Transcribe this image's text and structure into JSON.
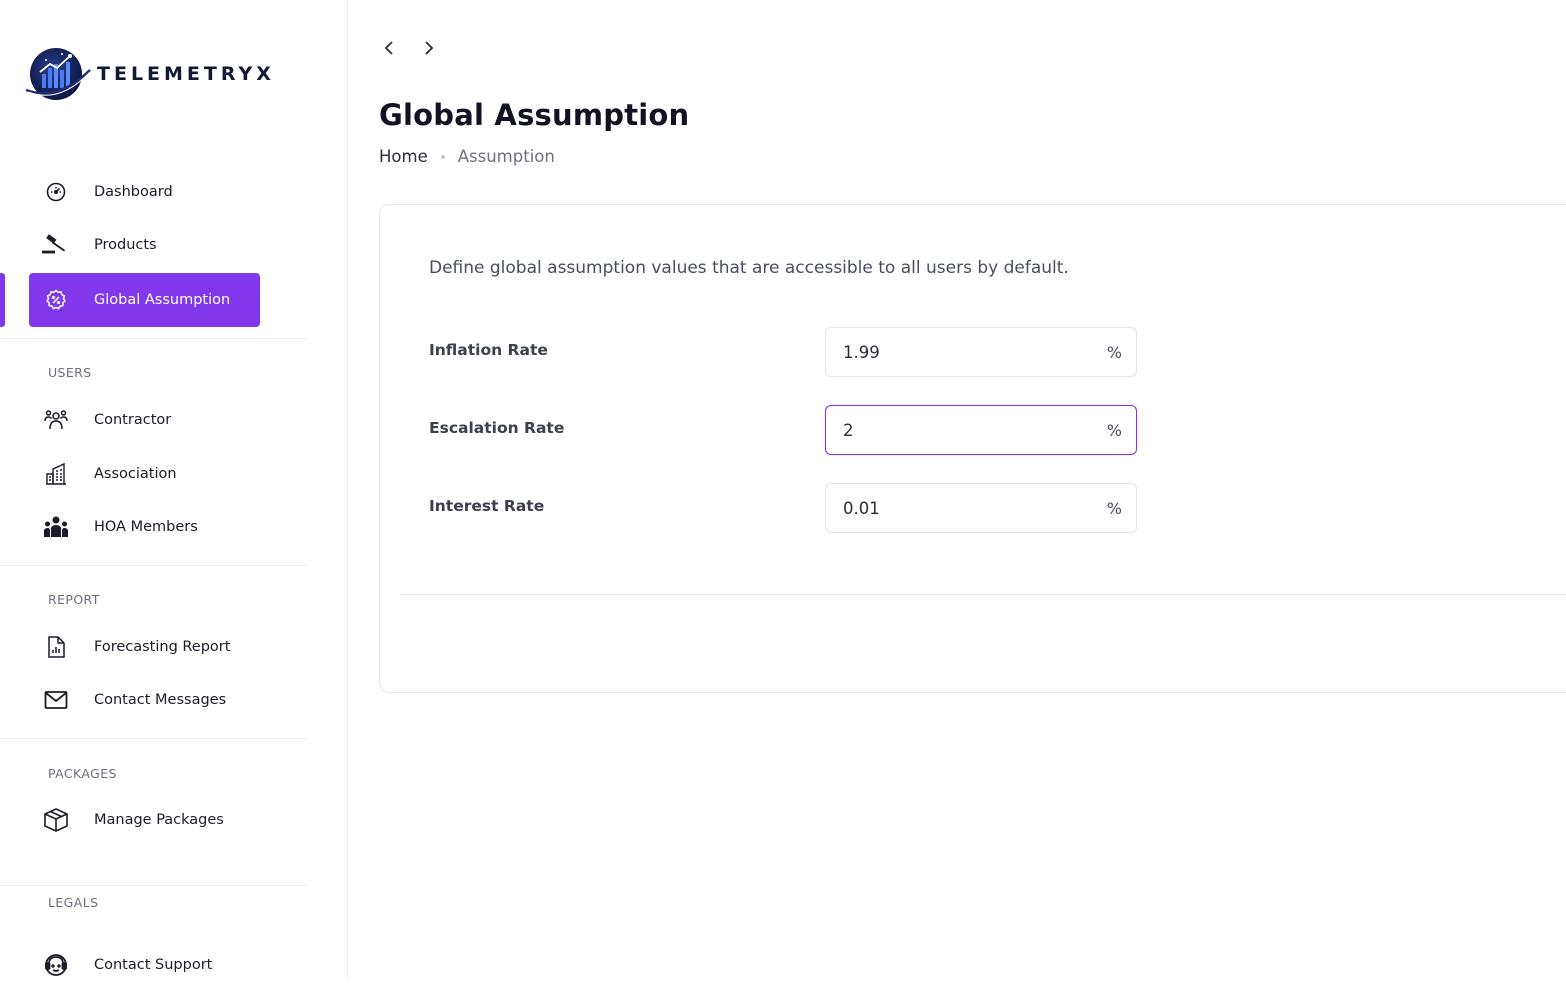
{
  "brand": {
    "name": "TELEMETRYX"
  },
  "sidebar": {
    "items": [
      {
        "label": "Dashboard",
        "icon": "dashboard-gauge-icon"
      },
      {
        "label": "Products",
        "icon": "gavel-icon"
      },
      {
        "label": "Global Assumption",
        "icon": "percent-badge-icon",
        "active": true
      }
    ],
    "sections": [
      {
        "title": "USERS",
        "items": [
          {
            "label": "Contractor",
            "icon": "users-group-icon"
          },
          {
            "label": "Association",
            "icon": "building-icon"
          },
          {
            "label": "HOA Members",
            "icon": "people-icon"
          }
        ]
      },
      {
        "title": "REPORT",
        "items": [
          {
            "label": "Forecasting Report",
            "icon": "report-document-icon"
          },
          {
            "label": "Contact Messages",
            "icon": "envelope-icon"
          }
        ]
      },
      {
        "title": "PACKAGES",
        "items": [
          {
            "label": "Manage Packages",
            "icon": "package-box-icon"
          }
        ]
      },
      {
        "title": "LEGALS",
        "items": [
          {
            "label": "Contact Support",
            "icon": "support-headset-icon"
          }
        ]
      }
    ]
  },
  "header": {
    "title": "Global Assumption",
    "breadcrumb": {
      "home": "Home",
      "current": "Assumption"
    }
  },
  "card": {
    "description": "Define global assumption values that are accessible to all users by default.",
    "fields": [
      {
        "label": "Inflation Rate",
        "value": "1.99",
        "unit": "%"
      },
      {
        "label": "Escalation Rate",
        "value": "2",
        "unit": "%",
        "focused": true
      },
      {
        "label": "Interest Rate",
        "value": "0.01",
        "unit": "%"
      }
    ]
  },
  "colors": {
    "accent": "#8138ea",
    "text": "#1c1c28",
    "muted": "#6b6f7a"
  }
}
